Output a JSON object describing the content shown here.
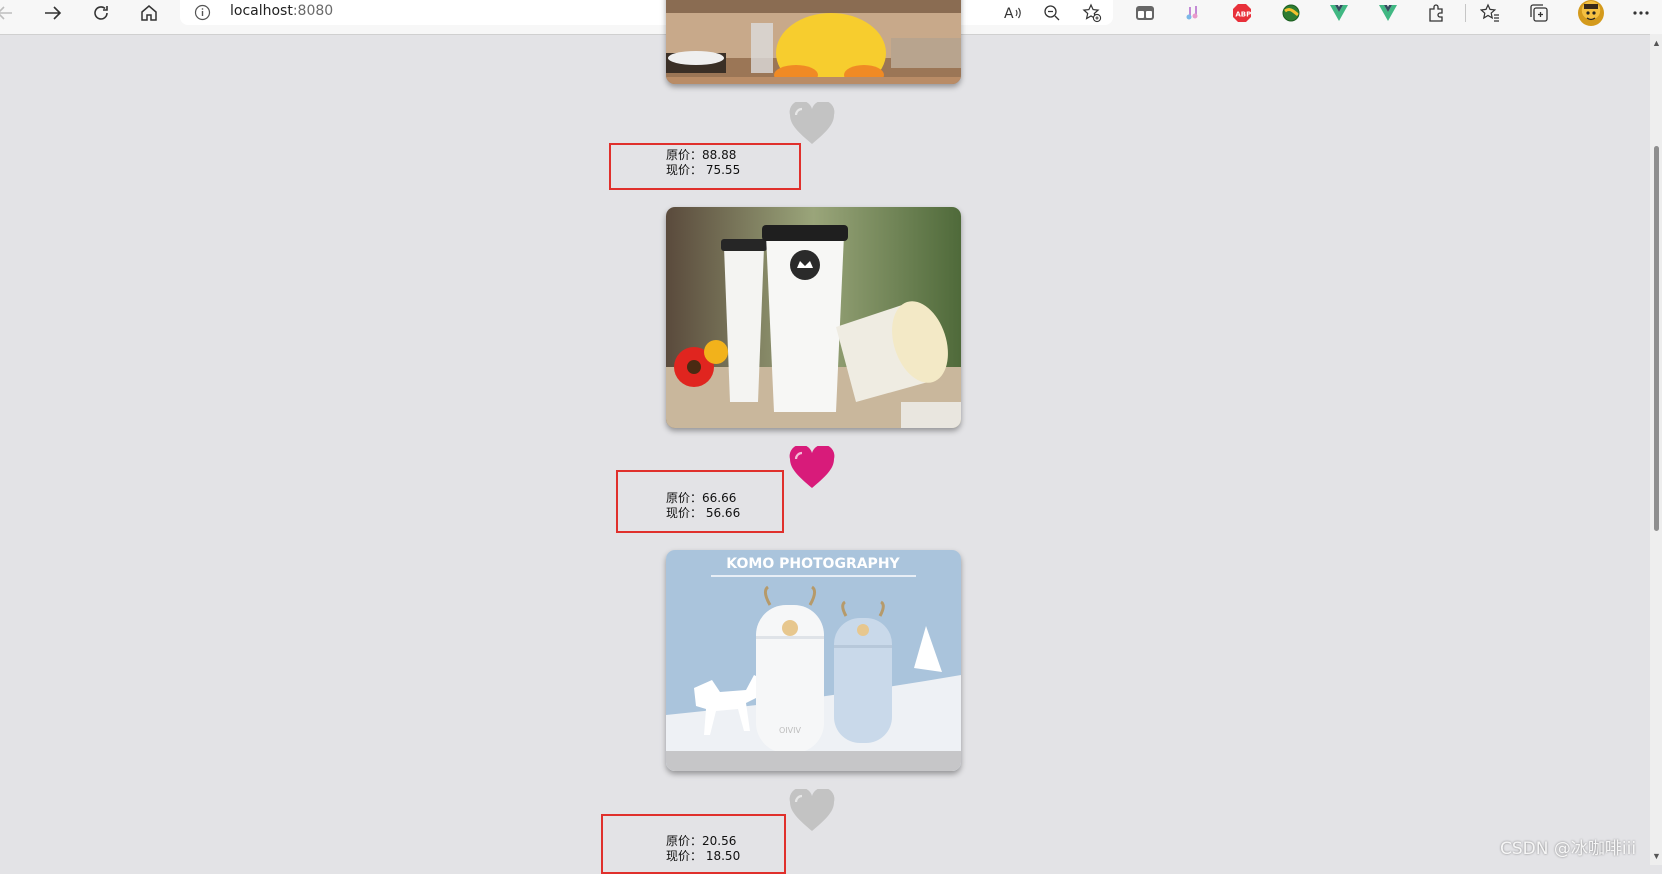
{
  "browser": {
    "url_host": "localhost",
    "url_port": ":8080"
  },
  "products": [
    {
      "original_label": "原价：",
      "original_price": "88.88",
      "current_label": "现价：",
      "current_price": "75.55",
      "liked": false
    },
    {
      "original_label": "原价：",
      "original_price": "66.66",
      "current_label": "现价：",
      "current_price": "56.66",
      "liked": true
    },
    {
      "original_label": "原价：",
      "original_price": "20.56",
      "current_label": "现价：",
      "current_price": "18.50",
      "liked": false
    }
  ],
  "product_images": {
    "third_banner_title": "KOMO PHOTOGRAPHY",
    "third_bottle_brand": "OIVIV"
  },
  "colors": {
    "heart_liked": "#d81b7a",
    "heart_unliked": "#c3c3c3",
    "price_box_border": "#e0302c"
  },
  "watermark": "CSDN @冰咖啡iii"
}
